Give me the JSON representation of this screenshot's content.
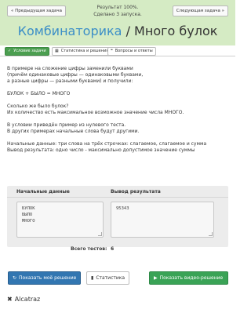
{
  "header": {
    "prev_label": "« Предыдущая задача",
    "next_label": "Следующая задача »",
    "result_line1": "Результат 100%.",
    "result_line2": "Сделано 3 запуска.",
    "title_link": "Комбинаторика",
    "title_sep": " / ",
    "title_text": "Много булок"
  },
  "tabs": {
    "condition": "Условие задачи",
    "stats": "Статистика и решения",
    "qa": "Вопросы и ответы"
  },
  "statement": [
    "В примере на сложение цифры заменили буквами",
    "(причём одинаковые цифры — одинаковыми буквами,",
    "а разные цифры — разными буквами) и получили:",
    "",
    "БУЛОК + БЫЛО = МНОГО",
    "",
    "Сколько же было булок?",
    "Их количество есть максимальное возможное значение числа МНОГО.",
    "",
    "В условии приведён пример из нулевого теста.",
    "В других примерах начальные слова будут другими.",
    "",
    "Начальные данные: три слова на трёх строчках: слагаемое, слагаемое и сумма",
    "Вывод результата: одно число - максимально допустимое значение суммы"
  ],
  "io": {
    "input_header": "Начальные данные",
    "output_header": "Вывод результата",
    "input_lines": [
      "БУЛОК",
      "БЫЛО",
      "МНОГО"
    ],
    "output_lines": [
      "95343"
    ],
    "tests_label": "Всего тестов:",
    "tests_count": "6"
  },
  "buttons": {
    "show_solution": "Показать моё решение",
    "statistics": "Статистика",
    "show_video": "Показать видео-решение"
  },
  "footer": {
    "brand": "Alcatraz"
  },
  "colors": {
    "header_bg": "#d5ebc4",
    "link": "#3b8ec7",
    "primary": "#3276b1",
    "success": "#3aa356"
  }
}
